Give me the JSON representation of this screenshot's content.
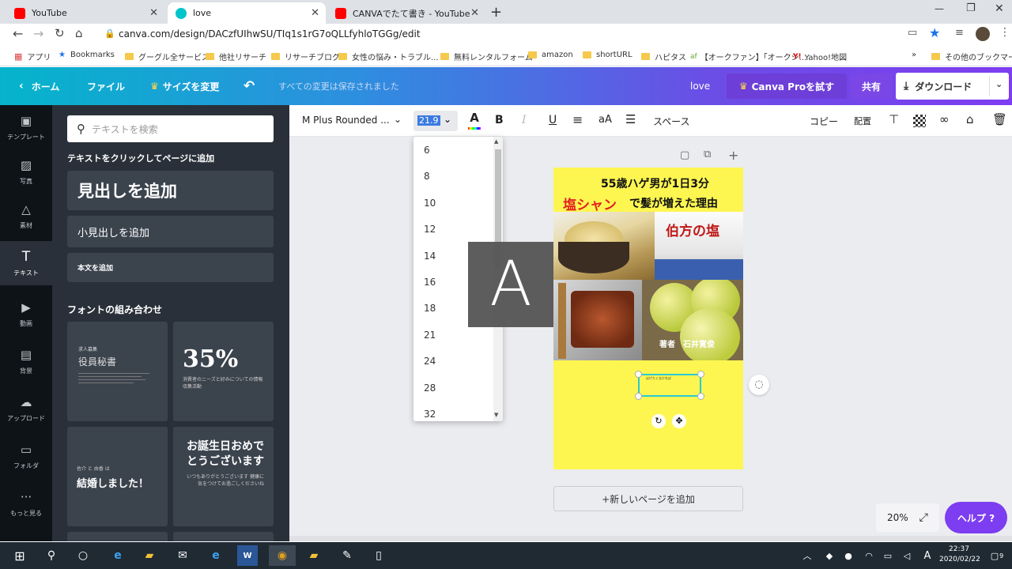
{
  "browser": {
    "tabs": [
      {
        "label": "YouTube",
        "color": "#ff0000"
      },
      {
        "label": "love",
        "color": "#00c4cc"
      },
      {
        "label": "CANVAでたて書き - YouTube",
        "color": "#ff0000"
      }
    ],
    "new_tab": "+",
    "url": "canva.com/design/DACzfUIhwSU/TIq1s1rG7oQLLfyhloTGGg/edit",
    "bookmarks": [
      "アプリ",
      "Bookmarks",
      "グーグル全サービス",
      "他社リサーチ",
      "リサーチブログ",
      "女性の悩み・トラブル...",
      "無料レンタルフォーム",
      "amazon",
      "shortURL",
      "ハピタス",
      "【オークファン】｢オークシ...",
      "Yahoo!地図"
    ],
    "bookmarks_more": "»",
    "other_bookmarks": "その他のブックマーク"
  },
  "canva_header": {
    "home": "ホーム",
    "file": "ファイル",
    "resize": "サイズを変更",
    "saved_status": "すべての変更は保存されました",
    "design_name": "love",
    "pro": "Canva Proを試す",
    "share": "共有",
    "download": "ダウンロード"
  },
  "rail": [
    {
      "label": "テンプレート",
      "icon": "layout-icon"
    },
    {
      "label": "写真",
      "icon": "photo-icon"
    },
    {
      "label": "素材",
      "icon": "elements-icon"
    },
    {
      "label": "テキスト",
      "icon": "text-icon"
    },
    {
      "label": "動画",
      "icon": "video-icon"
    },
    {
      "label": "背景",
      "icon": "background-icon"
    },
    {
      "label": "アップロード",
      "icon": "upload-icon"
    },
    {
      "label": "フォルダ",
      "icon": "folder-icon"
    },
    {
      "label": "もっと見る",
      "icon": "more-icon"
    }
  ],
  "panel": {
    "search_placeholder": "テキストを検索",
    "add_title": "テキストをクリックしてページに追加",
    "heading": "見出しを追加",
    "subheading": "小見出しを追加",
    "body": "本文を追加",
    "combos_title": "フォントの組み合わせ",
    "card1_small": "求人募集",
    "card1_title": "役員秘書",
    "card2_big": "35%",
    "card2_sub": "消費者のニーズと好みについての情報収集活動",
    "card3_small": "佐介 と 由香 は",
    "card3_title": "結婚しました！",
    "card4_title": "お誕生日おめでとうございます",
    "card4_sub": "いつもありがとうございます 健康に気をつけてお過ごしくださいね"
  },
  "editbar": {
    "font": "M Plus Rounded ...",
    "size": "21.9",
    "bold": "B",
    "italic": "I",
    "underline": "U",
    "case": "aA",
    "spacing": "スペース",
    "copy": "コピー",
    "arrange": "配置"
  },
  "size_dropdown": [
    "6",
    "8",
    "10",
    "12",
    "14",
    "16",
    "18",
    "21",
    "24",
    "28",
    "32"
  ],
  "preview_letter": "A",
  "page": {
    "title_line1": "55歳ハゲ男が1日3分",
    "title_red": "塩シャン",
    "title_line2_rest": "で髪が増えた理由",
    "author": "著者　石井寛俊",
    "salt_label": "伯方の塩",
    "textbox_text": "はげたくなければ"
  },
  "add_page": "+新しいページを追加",
  "zoom": "20%",
  "help": "ヘルプ ?",
  "taskbar": {
    "time": "22:37",
    "date": "2020/02/22",
    "notify": "9",
    "ime": "A"
  }
}
